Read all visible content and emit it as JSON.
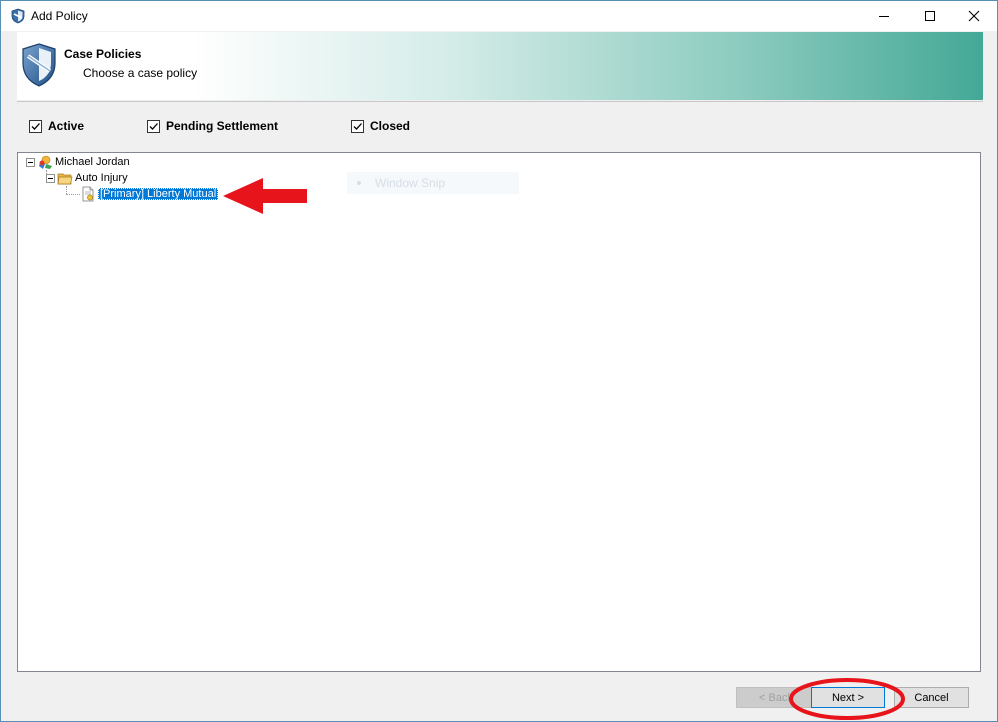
{
  "window": {
    "title": "Add Policy"
  },
  "banner": {
    "title": "Case Policies",
    "subtitle": "Choose a case policy"
  },
  "filters": [
    {
      "label": "Active",
      "checked": true
    },
    {
      "label": "Pending Settlement",
      "checked": true
    },
    {
      "label": "Closed",
      "checked": true
    }
  ],
  "tree": {
    "root": {
      "label": "Michael Jordan",
      "icon": "contact-icon"
    },
    "case": {
      "label": "Auto Injury",
      "icon": "folder-icon"
    },
    "policy": {
      "label": "[Primary] Liberty Mutual",
      "icon": "policy-document-icon",
      "selected": true
    }
  },
  "overlay": {
    "snip_label": "Window Snip"
  },
  "buttons": {
    "back": "< Back",
    "next": "Next >",
    "cancel": "Cancel"
  },
  "annotation_colors": {
    "arrow": "#e8141b",
    "circle": "#e8141b"
  },
  "colors": {
    "selection": "#0078d7",
    "banner_end": "#44a896"
  }
}
